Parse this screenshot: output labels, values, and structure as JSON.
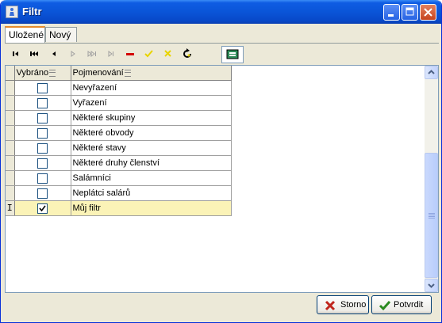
{
  "window": {
    "title": "Filtr"
  },
  "tabs": [
    {
      "label": "Uložené",
      "active": true
    },
    {
      "label": "Nový",
      "active": false
    }
  ],
  "toolbar": {
    "buttons": [
      "first-record-icon",
      "prior-page-icon",
      "prior-record-icon",
      "next-record-icon",
      "next-page-icon",
      "last-record-icon",
      "delete-record-icon",
      "post-edit-icon",
      "cancel-edit-icon",
      "refresh-icon"
    ],
    "exit_icon": "exit-door-icon"
  },
  "grid": {
    "columns": [
      {
        "label": "Vybráno"
      },
      {
        "label": "Pojmenování"
      }
    ],
    "rows": [
      {
        "name": "Nevyřazení",
        "checked": false
      },
      {
        "name": "Vyřazení",
        "checked": false
      },
      {
        "name": "Některé skupiny",
        "checked": false
      },
      {
        "name": "Některé obvody",
        "checked": false
      },
      {
        "name": "Některé stavy",
        "checked": false
      },
      {
        "name": "Některé druhy členství",
        "checked": false
      },
      {
        "name": "Salámníci",
        "checked": false
      },
      {
        "name": "Neplátci salárů",
        "checked": false
      },
      {
        "name": "Můj filtr",
        "checked": true,
        "current": true
      }
    ],
    "current_indicator": "I"
  },
  "buttons": {
    "cancel": "Storno",
    "confirm": "Potvrdit"
  },
  "colors": {
    "titlebar": "#0a55d8",
    "current_row": "#fbf3b7",
    "cancel_icon": "#c0261e",
    "confirm_icon": "#2a8a1f"
  }
}
